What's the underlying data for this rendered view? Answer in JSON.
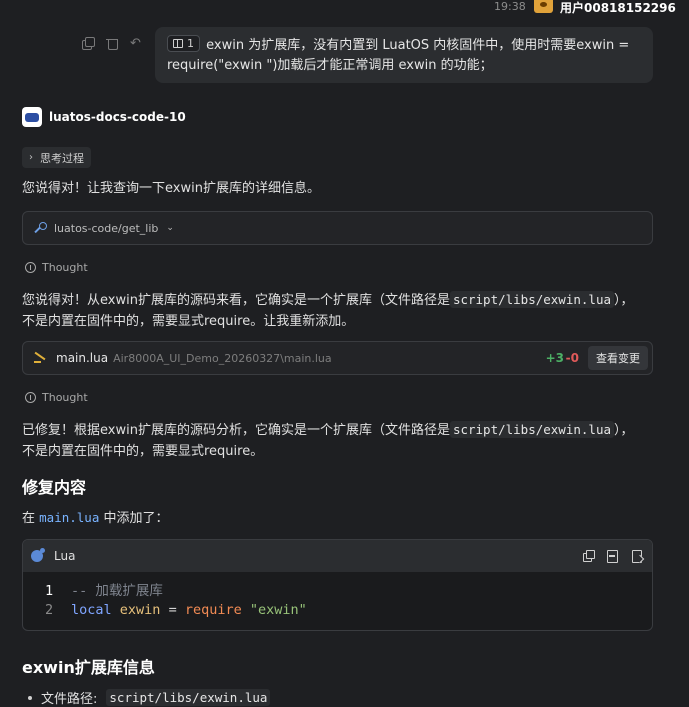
{
  "header": {
    "time": "19:38",
    "user": "用户00818152296"
  },
  "user_message": {
    "ref_count": "1",
    "line1": "exwin 为扩展库，没有内置到 LuatOS 内核固件中，使用时需要exwin =",
    "line2": "require(\"exwin \")加载后才能正常调用 exwin 的功能；"
  },
  "assistant": {
    "name": "luatos-docs-code-10",
    "thinking_label": "思考过程",
    "intro": "您说得对！让我查询一下exwin扩展库的详细信息。",
    "tool_call": {
      "label": "luatos-code/get_lib"
    },
    "thought1": "Thought",
    "para1": {
      "pre": "您说得对！从exwin扩展库的源码来看，它确实是一个扩展库（文件路径是",
      "code": "script/libs/exwin.lua",
      "post": "），",
      "line2": "不是内置在固件中的，需要显式require。让我重新添加。"
    },
    "file_change": {
      "name": "main.lua",
      "path": "Air8000A_UI_Demo_20260327\\main.lua",
      "added": "+3",
      "removed": "-0",
      "view_label": "查看变更"
    },
    "thought2": "Thought",
    "para2": {
      "pre": "已修复！根据exwin扩展库的源码分析，它确实是一个扩展库（文件路径是",
      "code": "script/libs/exwin.lua",
      "post": "），",
      "line2": "不是内置在固件中的，需要显式require。"
    },
    "section1_title": "修复内容",
    "added_in": {
      "pre": "在",
      "code": "main.lua",
      "post": "中添加了："
    },
    "code_block": {
      "language": "Lua",
      "lines": [
        {
          "num": "1",
          "comment": "-- 加载扩展库"
        },
        {
          "num": "2",
          "kw": "local",
          "var": "exwin",
          "op": "=",
          "fn": "require",
          "str": "\"exwin\""
        }
      ]
    },
    "section2_title": "exwin扩展库信息",
    "info_item": {
      "label": "文件路径:",
      "code": "script/libs/exwin.lua"
    }
  }
}
